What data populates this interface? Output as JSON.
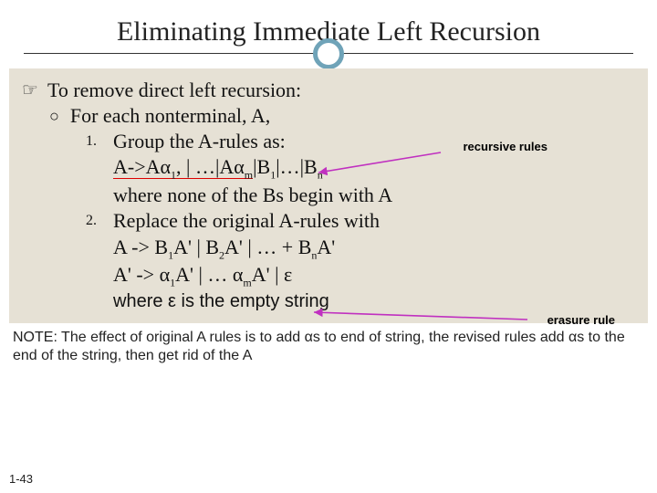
{
  "slide": {
    "title": "Eliminating Immediate Left Recursion",
    "level1": "To remove direct left recursion:",
    "level2": "For each nonterminal, A,",
    "step1_num": "1.",
    "step1_intro": "Group the A-rules as:",
    "step1_prod_head": "A->A",
    "step1_a1": "α",
    "step1_a1_sub": "1",
    "step1_mid": ", | …|A",
    "step1_am": "α",
    "step1_am_sub": "m",
    "step1_tail_b": "|B",
    "step1_b1_sub": "1",
    "step1_tail_mid": "|…|B",
    "step1_bn_sub": "n",
    "step1_where": "where none of the Bs begin with A",
    "step2_num": "2.",
    "step2_intro": "Replace the original A-rules with",
    "step2_line1_a": "A -> B",
    "step2_l1_s1": "1",
    "step2_line1_b": "A' | B",
    "step2_l1_s2": "2",
    "step2_line1_c": "A' | … + B",
    "step2_l1_sn": "n",
    "step2_line1_d": "A'",
    "step2_line2_a": "A' -> α",
    "step2_l2_s1": "1",
    "step2_line2_b": "A' | … α",
    "step2_l2_sm": "m",
    "step2_line2_c": "A' | ε",
    "step2_where": "where ε is the empty string",
    "annot_recursive": "recursive rules",
    "annot_erasure": "erasure rule",
    "note_text": "NOTE: The effect of original A rules is to add αs to end of string, the revised rules add αs to the end of the string, then get rid of the A",
    "pagenum": "1-43"
  }
}
